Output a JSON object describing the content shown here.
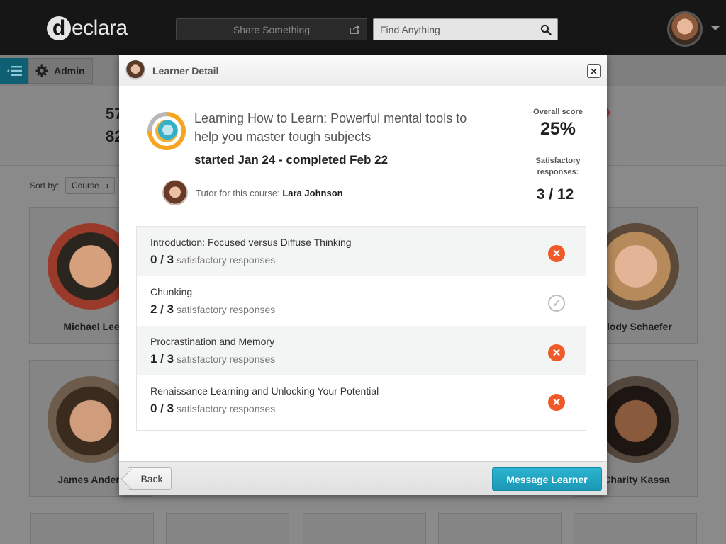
{
  "topbar": {
    "logo_letter": "d",
    "logo_text": "eclara",
    "share_placeholder": "Share Something",
    "search_placeholder": "Find Anything"
  },
  "toolbar": {
    "admin_label": "Admin"
  },
  "page": {
    "stat_1": "57",
    "stat_2": "82",
    "sort_label": "Sort by:",
    "sort_value": "Course",
    "learners": [
      {
        "name": "Michael Lee"
      },
      {
        "name": "elody Schaefer"
      },
      {
        "name": "James Anders"
      },
      {
        "name": "Charity Kassa"
      }
    ]
  },
  "modal": {
    "title": "Learner Detail",
    "course_title": "Learning How to Learn: Powerful mental tools to help you master tough subjects",
    "dates": "started Jan 24 - completed Feb 22",
    "tutor_label": "Tutor for this course:",
    "tutor_name": "Lara Johnson",
    "overall_score_label": "Overall score",
    "overall_score": "25%",
    "satisfactory_label": "Satisfactory responses:",
    "satisfactory_value": "3 / 12",
    "modules": [
      {
        "name": "Introduction: Focused versus Diffuse Thinking",
        "score": "0 / 3",
        "suffix": "satisfactory responses",
        "status": "fail"
      },
      {
        "name": "Chunking",
        "score": "2 / 3",
        "suffix": "satisfactory responses",
        "status": "pass"
      },
      {
        "name": "Procrastination and Memory",
        "score": "1 / 3",
        "suffix": "satisfactory responses",
        "status": "fail"
      },
      {
        "name": "Renaissance Learning and Unlocking Your Potential",
        "score": "0 / 3",
        "suffix": "satisfactory responses",
        "status": "fail"
      }
    ],
    "back_label": "Back",
    "message_label": "Message Learner"
  },
  "colors": {
    "accent": "#1fa6c3",
    "fail": "#f05a28",
    "pass": "#bfbfbf",
    "progress": "#f5a522"
  }
}
